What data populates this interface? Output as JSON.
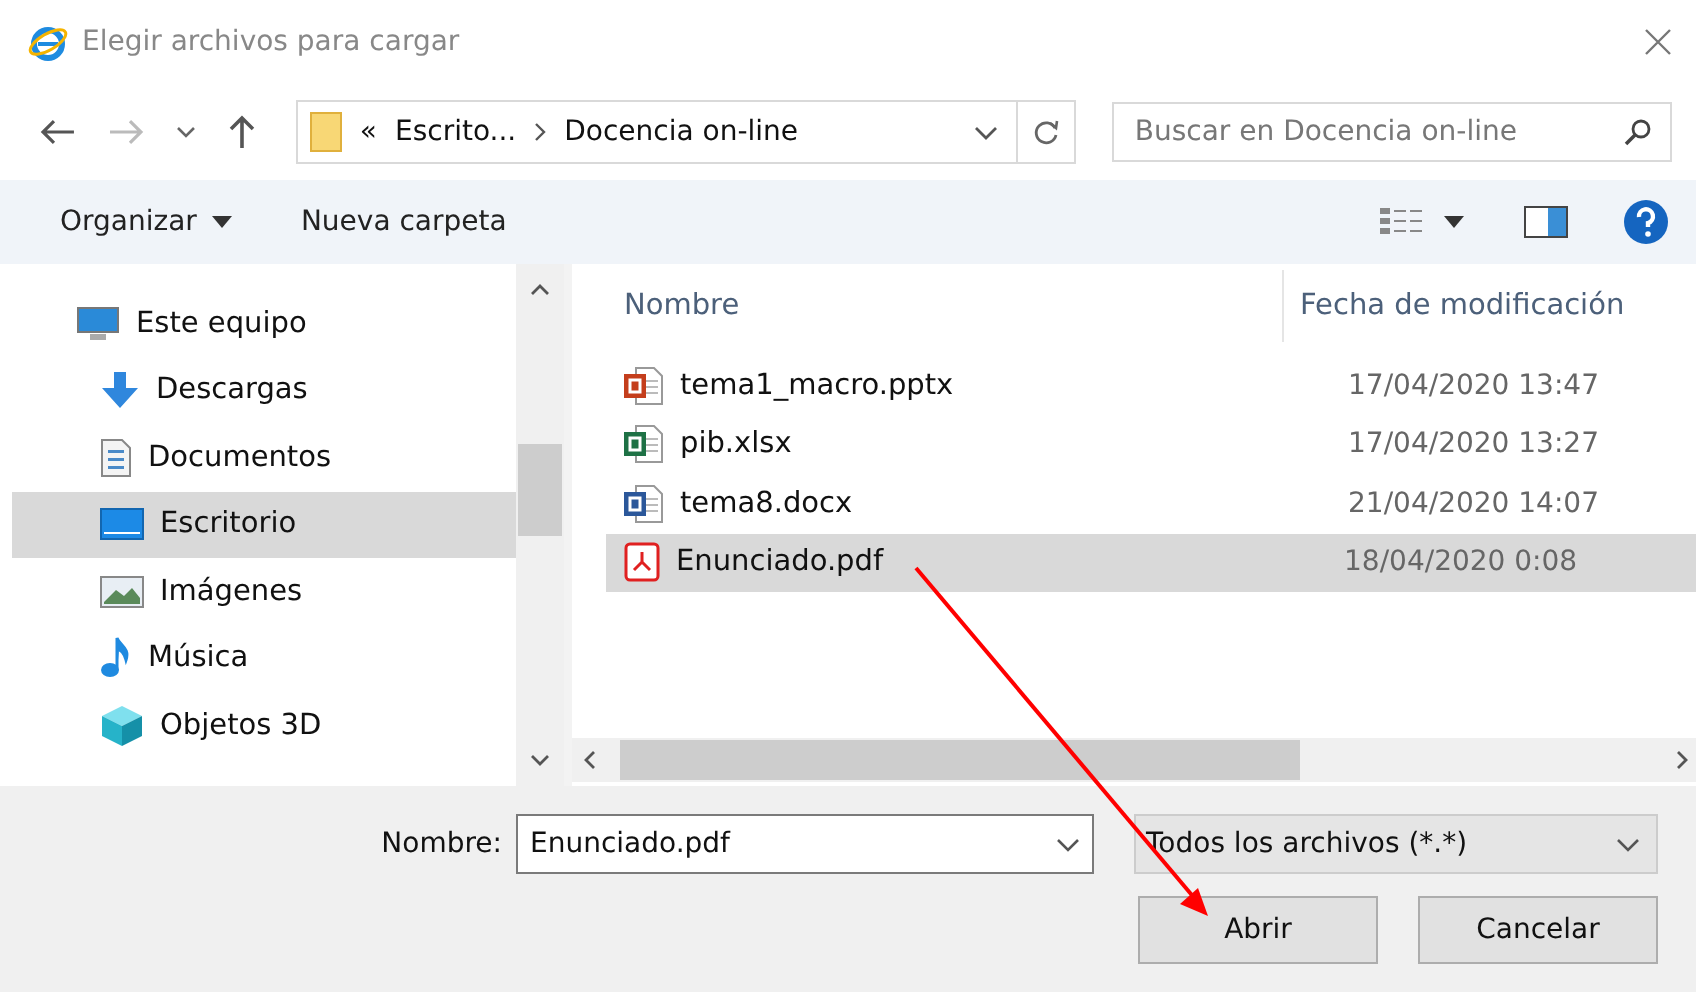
{
  "window": {
    "title": "Elegir archivos para cargar"
  },
  "address": {
    "overflow": "«",
    "crumbs": [
      "Escrito...",
      "Docencia on-line"
    ]
  },
  "search": {
    "placeholder": "Buscar en Docencia on-line"
  },
  "toolbar": {
    "organize": "Organizar",
    "new_folder": "Nueva carpeta"
  },
  "sidebar": {
    "items": [
      {
        "label": "Este equipo",
        "kind": "computer",
        "selected": false,
        "children": [
          {
            "label": "Descargas",
            "kind": "downloads",
            "selected": false
          },
          {
            "label": "Documentos",
            "kind": "documents",
            "selected": false
          },
          {
            "label": "Escritorio",
            "kind": "desktop",
            "selected": true
          },
          {
            "label": "Imágenes",
            "kind": "pictures",
            "selected": false
          },
          {
            "label": "Música",
            "kind": "music",
            "selected": false
          },
          {
            "label": "Objetos 3D",
            "kind": "objects3d",
            "selected": false
          }
        ]
      }
    ]
  },
  "file_list": {
    "columns": [
      "Nombre",
      "Fecha de modificación"
    ],
    "rows": [
      {
        "name": "tema1_macro.pptx",
        "kind": "pptx",
        "date": "17/04/2020 13:47",
        "selected": false
      },
      {
        "name": "pib.xlsx",
        "kind": "xlsx",
        "date": "17/04/2020 13:27",
        "selected": false
      },
      {
        "name": "tema8.docx",
        "kind": "docx",
        "date": "21/04/2020 14:07",
        "selected": false
      },
      {
        "name": "Enunciado.pdf",
        "kind": "pdf",
        "date": "18/04/2020 0:08",
        "selected": true
      }
    ]
  },
  "footer": {
    "name_label": "Nombre:",
    "name_value": "Enunciado.pdf",
    "filter": "Todos los archivos (*.*)",
    "buttons": [
      "Abrir",
      "Cancelar"
    ]
  }
}
